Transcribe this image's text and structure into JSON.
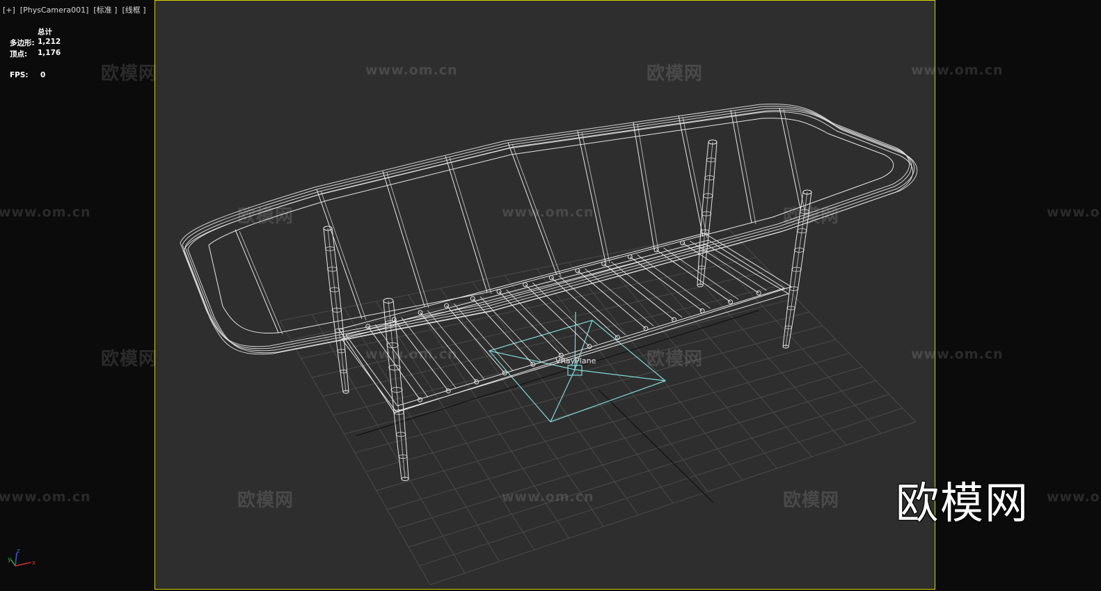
{
  "viewport": {
    "label": "[+]  [PhysCamera001]  [标准 ]  [线框 ]"
  },
  "stats": {
    "header": "总计",
    "polygons_label": "多边形:",
    "polygons_value": "1,212",
    "vertices_label": "顶点:",
    "vertices_value": "1,176",
    "fps_label": "FPS:",
    "fps_value": "0"
  },
  "object_label": "VRayPlane",
  "watermarks": {
    "cn": "欧模网",
    "url": "www.om.cn"
  },
  "brand_watermark": "欧模网",
  "axis_labels": {
    "x": "x",
    "y": "y",
    "z": "z"
  },
  "colors": {
    "viewport_bg": "#2e2e2e",
    "outer_bg": "#0b0b0b",
    "safe_frame": "#d6d600",
    "wireframe": "#e8e8e8",
    "grid": "#4a4a4a",
    "vray_plane": "#7fd9d9"
  }
}
